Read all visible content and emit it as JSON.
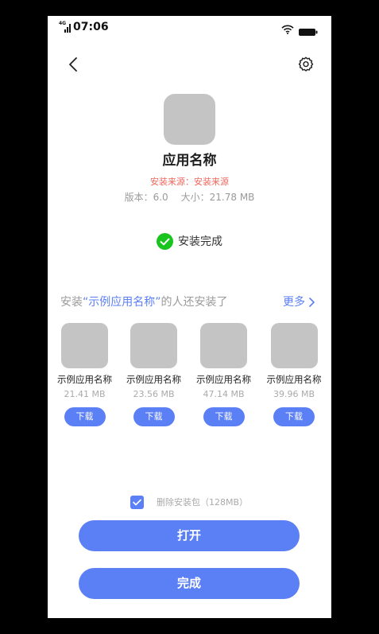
{
  "status_bar": {
    "network": "4G",
    "time": "07:06",
    "icons": [
      "signal-icon",
      "wifi-icon",
      "battery-icon"
    ]
  },
  "header": {
    "icons": [
      "chevron-left-icon",
      "gear-icon"
    ]
  },
  "app": {
    "name": "应用名称",
    "source": "安装来源：安装来源",
    "version": "版本：6.0",
    "size": "大小：21.78 MB"
  },
  "install_status": {
    "icon": "check-circle-icon",
    "text": "安装完成"
  },
  "recommend": {
    "prefix": "安装",
    "highlight": "“示例应用名称”",
    "suffix": "的人还安装了",
    "more": "更多"
  },
  "apps": [
    {
      "name": "示例应用名称",
      "size": "21.41 MB",
      "button": "下载"
    },
    {
      "name": "示例应用名称",
      "size": "23.56 MB",
      "button": "下载"
    },
    {
      "name": "示例应用名称",
      "size": "47.14 MB",
      "button": "下载"
    },
    {
      "name": "示例应用名称",
      "size": "39.96 MB",
      "button": "下载"
    }
  ],
  "delete_package": {
    "checked": true,
    "label": "删除安装包（128MB）"
  },
  "buttons": {
    "open": "打开",
    "done": "完成"
  },
  "colors": {
    "blue": "#5b7ff5",
    "gray-icon": "#c4c4c4",
    "red": "#f0675c",
    "green": "#19c41e"
  }
}
